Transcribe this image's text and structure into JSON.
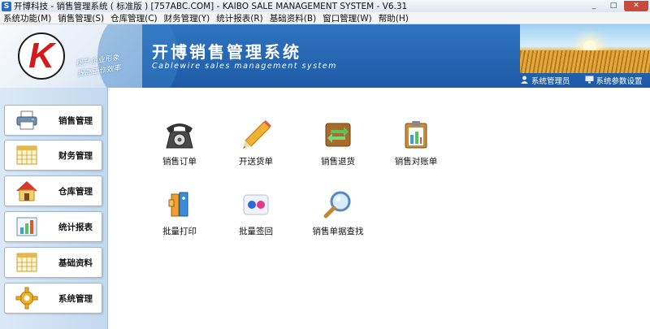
{
  "window": {
    "title": "开博科技 - 销售管理系统 ( 标准版 ) [757ABC.COM] - KAIBO SALE MANAGEMENT SYSTEM - V6.31",
    "controls": [
      "_",
      "□",
      "✕"
    ]
  },
  "menu": [
    "系统功能(M)",
    "销售管理(S)",
    "仓库管理(C)",
    "财务管理(Y)",
    "统计报表(R)",
    "基础资料(B)",
    "窗口管理(W)",
    "帮助(H)"
  ],
  "banner": {
    "logo_letter": "K",
    "slogan_line1": "提升企业形象",
    "slogan_line2": "提高工作效率",
    "title": "开博销售管理系统",
    "subtitle": "Cablewire sales management system",
    "user": "系统管理员",
    "settings": "系统参数设置"
  },
  "sidebar": {
    "items": [
      {
        "label": "销售管理",
        "icon": "printer-icon"
      },
      {
        "label": "财务管理",
        "icon": "calendar-grid-icon"
      },
      {
        "label": "仓库管理",
        "icon": "house-icon"
      },
      {
        "label": "统计报表",
        "icon": "bar-chart-icon"
      },
      {
        "label": "基础资料",
        "icon": "calendar-grid-icon"
      },
      {
        "label": "系统管理",
        "icon": "gear-icon"
      }
    ]
  },
  "main": {
    "tiles": [
      {
        "label": "销售订单",
        "icon": "telephone-icon"
      },
      {
        "label": "开送货单",
        "icon": "pencil-icon"
      },
      {
        "label": "销售退货",
        "icon": "return-arrows-icon"
      },
      {
        "label": "销售对账单",
        "icon": "clipboard-icon"
      },
      {
        "label": "批量打印",
        "icon": "binders-icon"
      },
      {
        "label": "批量签回",
        "icon": "dots-icon"
      },
      {
        "label": "销售单据查找",
        "icon": "magnifier-icon"
      }
    ]
  },
  "colors": {
    "banner_blue": "#2f74c0",
    "sidebar_bg": "#c3d7ee",
    "logo_red": "#d21b1b"
  }
}
